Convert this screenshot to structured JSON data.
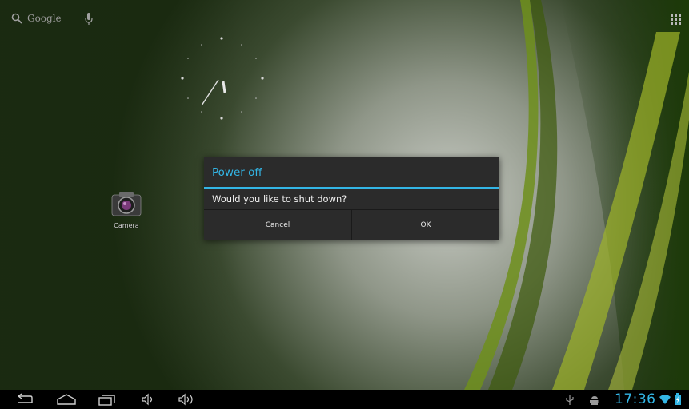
{
  "search": {
    "label": "Google"
  },
  "home": {
    "camera_label": "Camera"
  },
  "dialog": {
    "title": "Power off",
    "message": "Would you like to shut down?",
    "cancel_label": "Cancel",
    "ok_label": "OK"
  },
  "statusbar": {
    "time": "17:36"
  },
  "colors": {
    "accent": "#33b5e5",
    "dialog_bg": "#2b2b2b",
    "statusbar_bg": "#000000"
  },
  "icons": {
    "nav": [
      "back-icon",
      "home-icon",
      "recent-apps-icon",
      "volume-down-icon",
      "volume-up-icon"
    ],
    "status": [
      "usb-icon",
      "android-debug-icon",
      "wifi-icon",
      "battery-icon"
    ]
  }
}
